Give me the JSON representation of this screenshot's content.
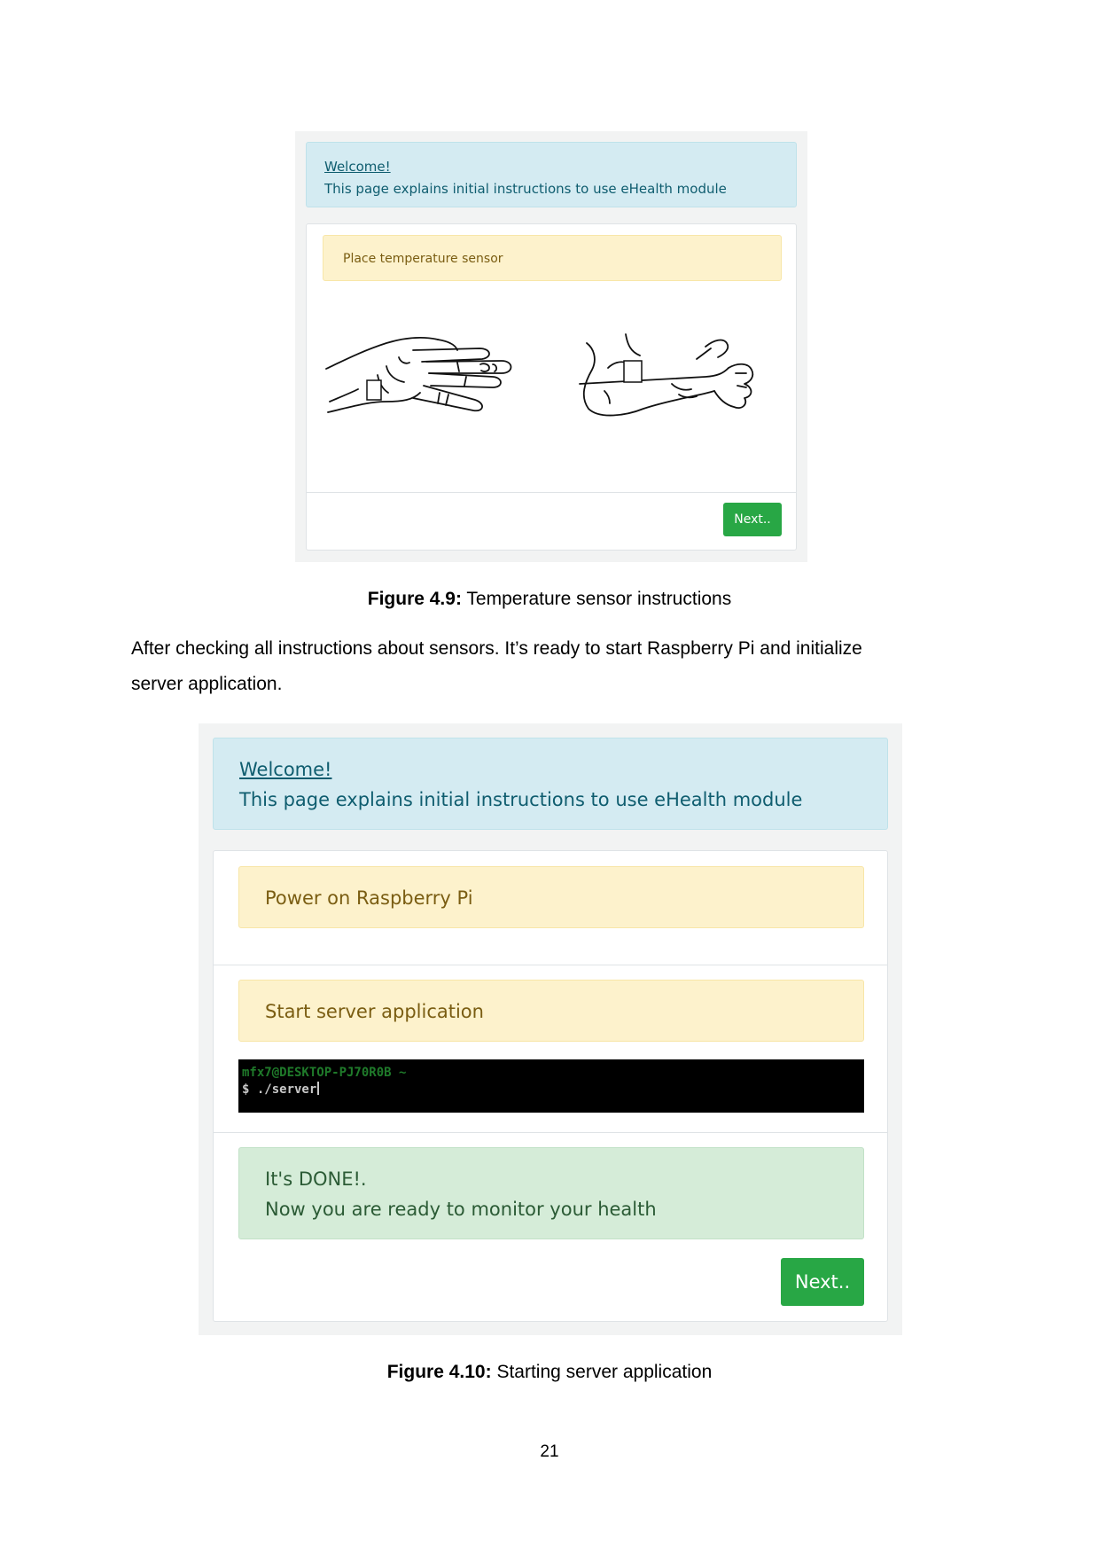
{
  "figure1": {
    "welcome_title": "Welcome!",
    "welcome_text": "This page explains initial instructions to use eHealth module",
    "step_label": "Place temperature sensor",
    "next_button": "Next..",
    "caption_label": "Figure 4.9:",
    "caption_text": "Temperature sensor instructions"
  },
  "paragraph": {
    "line1": "After checking all instructions about sensors. It’s ready to start Raspberry Pi and initialize",
    "line2": "server application."
  },
  "figure2": {
    "welcome_title": "Welcome!",
    "welcome_text": "This page explains initial instructions to use eHealth module",
    "step1_label": "Power on Raspberry Pi",
    "step2_label": "Start server application",
    "terminal_prompt": "mfx7@DESKTOP-PJ70R0B ~",
    "terminal_command": "$ ./server",
    "done_title": "It's DONE!.",
    "done_text": "Now you are ready to monitor your health",
    "next_button": "Next..",
    "caption_label": "Figure 4.10:",
    "caption_text": "Starting server application"
  },
  "page_number": "21",
  "colors": {
    "info_bg": "#d4ebf2",
    "warning_bg": "#fdf2cc",
    "success_bg": "#d5ecd8",
    "button_green": "#28a745"
  }
}
